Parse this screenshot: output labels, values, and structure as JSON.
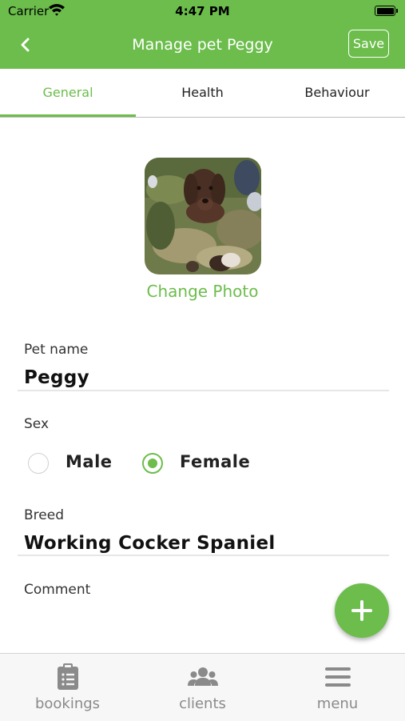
{
  "status_bar": {
    "carrier": "Carrier",
    "time": "4:47 PM"
  },
  "navbar": {
    "title": "Manage pet Peggy",
    "save_label": "Save"
  },
  "tabs": [
    {
      "label": "General",
      "active": true
    },
    {
      "label": "Health",
      "active": false
    },
    {
      "label": "Behaviour",
      "active": false
    }
  ],
  "photo": {
    "change_label": "Change Photo"
  },
  "form": {
    "pet_name_label": "Pet name",
    "pet_name_value": "Peggy",
    "sex_label": "Sex",
    "sex_options": [
      {
        "label": "Male",
        "selected": false
      },
      {
        "label": "Female",
        "selected": true
      }
    ],
    "breed_label": "Breed",
    "breed_value": "Working Cocker Spaniel",
    "comment_label": "Comment"
  },
  "bottom_nav": [
    {
      "label": "bookings",
      "icon": "clipboard-list-icon"
    },
    {
      "label": "clients",
      "icon": "users-icon"
    },
    {
      "label": "menu",
      "icon": "hamburger-menu-icon"
    }
  ],
  "colors": {
    "accent": "#6cbd4c",
    "inactive": "#8a8a8a"
  }
}
